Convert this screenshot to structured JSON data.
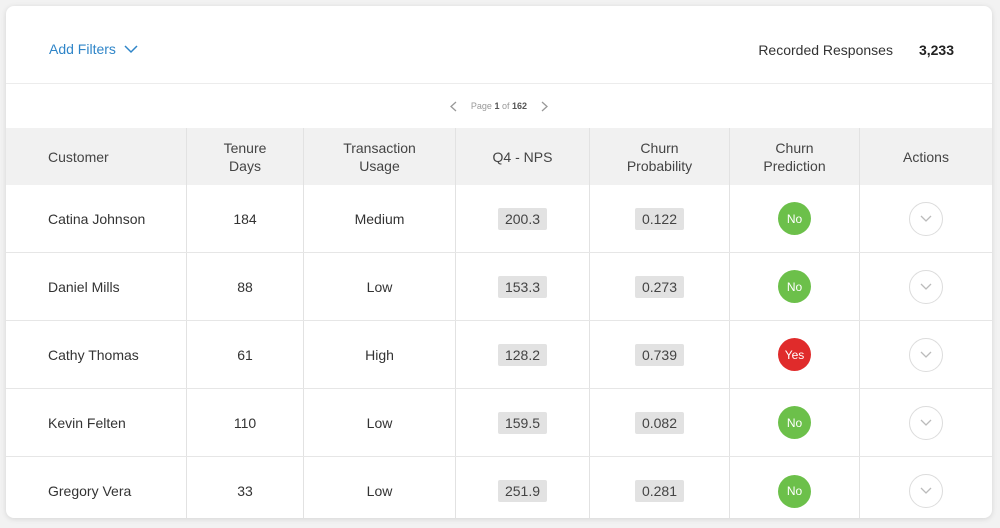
{
  "header": {
    "add_filters_label": "Add Filters",
    "recorded_label": "Recorded Responses",
    "recorded_count": "3,233"
  },
  "pagination": {
    "prefix": "Page",
    "current": "1",
    "of": "of",
    "total": "162"
  },
  "table": {
    "columns": [
      "Customer",
      "Tenure\nDays",
      "Transaction\nUsage",
      "Q4 - NPS",
      "Churn\nProbability",
      "Churn\nPrediction",
      "Actions"
    ],
    "rows": [
      {
        "customer": "Catina Johnson",
        "tenure": "184",
        "usage": "Medium",
        "nps": "200.3",
        "probability": "0.122",
        "prediction": "No"
      },
      {
        "customer": "Daniel Mills",
        "tenure": "88",
        "usage": "Low",
        "nps": "153.3",
        "probability": "0.273",
        "prediction": "No"
      },
      {
        "customer": "Cathy Thomas",
        "tenure": "61",
        "usage": "High",
        "nps": "128.2",
        "probability": "0.739",
        "prediction": "Yes"
      },
      {
        "customer": "Kevin Felten",
        "tenure": "110",
        "usage": "Low",
        "nps": "159.5",
        "probability": "0.082",
        "prediction": "No"
      },
      {
        "customer": "Gregory Vera",
        "tenure": "33",
        "usage": "Low",
        "nps": "251.9",
        "probability": "0.281",
        "prediction": "No"
      }
    ]
  },
  "icons": {
    "filter_dropdown": "chevron-down-icon",
    "prev_page": "chevron-left-icon",
    "next_page": "chevron-right-icon",
    "row_action": "chevron-down-icon"
  },
  "colors": {
    "accent": "#2f85c8",
    "prediction_no": "#6cc04a",
    "prediction_yes": "#e02b2b"
  }
}
